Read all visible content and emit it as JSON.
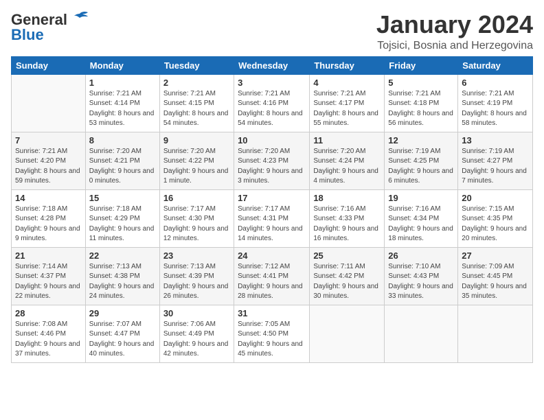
{
  "header": {
    "logo_general": "General",
    "logo_blue": "Blue",
    "month": "January 2024",
    "location": "Tojsici, Bosnia and Herzegovina"
  },
  "weekdays": [
    "Sunday",
    "Monday",
    "Tuesday",
    "Wednesday",
    "Thursday",
    "Friday",
    "Saturday"
  ],
  "weeks": [
    [
      {
        "day": "",
        "sunrise": "",
        "sunset": "",
        "daylight": ""
      },
      {
        "day": "1",
        "sunrise": "Sunrise: 7:21 AM",
        "sunset": "Sunset: 4:14 PM",
        "daylight": "Daylight: 8 hours and 53 minutes."
      },
      {
        "day": "2",
        "sunrise": "Sunrise: 7:21 AM",
        "sunset": "Sunset: 4:15 PM",
        "daylight": "Daylight: 8 hours and 54 minutes."
      },
      {
        "day": "3",
        "sunrise": "Sunrise: 7:21 AM",
        "sunset": "Sunset: 4:16 PM",
        "daylight": "Daylight: 8 hours and 54 minutes."
      },
      {
        "day": "4",
        "sunrise": "Sunrise: 7:21 AM",
        "sunset": "Sunset: 4:17 PM",
        "daylight": "Daylight: 8 hours and 55 minutes."
      },
      {
        "day": "5",
        "sunrise": "Sunrise: 7:21 AM",
        "sunset": "Sunset: 4:18 PM",
        "daylight": "Daylight: 8 hours and 56 minutes."
      },
      {
        "day": "6",
        "sunrise": "Sunrise: 7:21 AM",
        "sunset": "Sunset: 4:19 PM",
        "daylight": "Daylight: 8 hours and 58 minutes."
      }
    ],
    [
      {
        "day": "7",
        "sunrise": "Sunrise: 7:21 AM",
        "sunset": "Sunset: 4:20 PM",
        "daylight": "Daylight: 8 hours and 59 minutes."
      },
      {
        "day": "8",
        "sunrise": "Sunrise: 7:20 AM",
        "sunset": "Sunset: 4:21 PM",
        "daylight": "Daylight: 9 hours and 0 minutes."
      },
      {
        "day": "9",
        "sunrise": "Sunrise: 7:20 AM",
        "sunset": "Sunset: 4:22 PM",
        "daylight": "Daylight: 9 hours and 1 minute."
      },
      {
        "day": "10",
        "sunrise": "Sunrise: 7:20 AM",
        "sunset": "Sunset: 4:23 PM",
        "daylight": "Daylight: 9 hours and 3 minutes."
      },
      {
        "day": "11",
        "sunrise": "Sunrise: 7:20 AM",
        "sunset": "Sunset: 4:24 PM",
        "daylight": "Daylight: 9 hours and 4 minutes."
      },
      {
        "day": "12",
        "sunrise": "Sunrise: 7:19 AM",
        "sunset": "Sunset: 4:25 PM",
        "daylight": "Daylight: 9 hours and 6 minutes."
      },
      {
        "day": "13",
        "sunrise": "Sunrise: 7:19 AM",
        "sunset": "Sunset: 4:27 PM",
        "daylight": "Daylight: 9 hours and 7 minutes."
      }
    ],
    [
      {
        "day": "14",
        "sunrise": "Sunrise: 7:18 AM",
        "sunset": "Sunset: 4:28 PM",
        "daylight": "Daylight: 9 hours and 9 minutes."
      },
      {
        "day": "15",
        "sunrise": "Sunrise: 7:18 AM",
        "sunset": "Sunset: 4:29 PM",
        "daylight": "Daylight: 9 hours and 11 minutes."
      },
      {
        "day": "16",
        "sunrise": "Sunrise: 7:17 AM",
        "sunset": "Sunset: 4:30 PM",
        "daylight": "Daylight: 9 hours and 12 minutes."
      },
      {
        "day": "17",
        "sunrise": "Sunrise: 7:17 AM",
        "sunset": "Sunset: 4:31 PM",
        "daylight": "Daylight: 9 hours and 14 minutes."
      },
      {
        "day": "18",
        "sunrise": "Sunrise: 7:16 AM",
        "sunset": "Sunset: 4:33 PM",
        "daylight": "Daylight: 9 hours and 16 minutes."
      },
      {
        "day": "19",
        "sunrise": "Sunrise: 7:16 AM",
        "sunset": "Sunset: 4:34 PM",
        "daylight": "Daylight: 9 hours and 18 minutes."
      },
      {
        "day": "20",
        "sunrise": "Sunrise: 7:15 AM",
        "sunset": "Sunset: 4:35 PM",
        "daylight": "Daylight: 9 hours and 20 minutes."
      }
    ],
    [
      {
        "day": "21",
        "sunrise": "Sunrise: 7:14 AM",
        "sunset": "Sunset: 4:37 PM",
        "daylight": "Daylight: 9 hours and 22 minutes."
      },
      {
        "day": "22",
        "sunrise": "Sunrise: 7:13 AM",
        "sunset": "Sunset: 4:38 PM",
        "daylight": "Daylight: 9 hours and 24 minutes."
      },
      {
        "day": "23",
        "sunrise": "Sunrise: 7:13 AM",
        "sunset": "Sunset: 4:39 PM",
        "daylight": "Daylight: 9 hours and 26 minutes."
      },
      {
        "day": "24",
        "sunrise": "Sunrise: 7:12 AM",
        "sunset": "Sunset: 4:41 PM",
        "daylight": "Daylight: 9 hours and 28 minutes."
      },
      {
        "day": "25",
        "sunrise": "Sunrise: 7:11 AM",
        "sunset": "Sunset: 4:42 PM",
        "daylight": "Daylight: 9 hours and 30 minutes."
      },
      {
        "day": "26",
        "sunrise": "Sunrise: 7:10 AM",
        "sunset": "Sunset: 4:43 PM",
        "daylight": "Daylight: 9 hours and 33 minutes."
      },
      {
        "day": "27",
        "sunrise": "Sunrise: 7:09 AM",
        "sunset": "Sunset: 4:45 PM",
        "daylight": "Daylight: 9 hours and 35 minutes."
      }
    ],
    [
      {
        "day": "28",
        "sunrise": "Sunrise: 7:08 AM",
        "sunset": "Sunset: 4:46 PM",
        "daylight": "Daylight: 9 hours and 37 minutes."
      },
      {
        "day": "29",
        "sunrise": "Sunrise: 7:07 AM",
        "sunset": "Sunset: 4:47 PM",
        "daylight": "Daylight: 9 hours and 40 minutes."
      },
      {
        "day": "30",
        "sunrise": "Sunrise: 7:06 AM",
        "sunset": "Sunset: 4:49 PM",
        "daylight": "Daylight: 9 hours and 42 minutes."
      },
      {
        "day": "31",
        "sunrise": "Sunrise: 7:05 AM",
        "sunset": "Sunset: 4:50 PM",
        "daylight": "Daylight: 9 hours and 45 minutes."
      },
      {
        "day": "",
        "sunrise": "",
        "sunset": "",
        "daylight": ""
      },
      {
        "day": "",
        "sunrise": "",
        "sunset": "",
        "daylight": ""
      },
      {
        "day": "",
        "sunrise": "",
        "sunset": "",
        "daylight": ""
      }
    ]
  ]
}
